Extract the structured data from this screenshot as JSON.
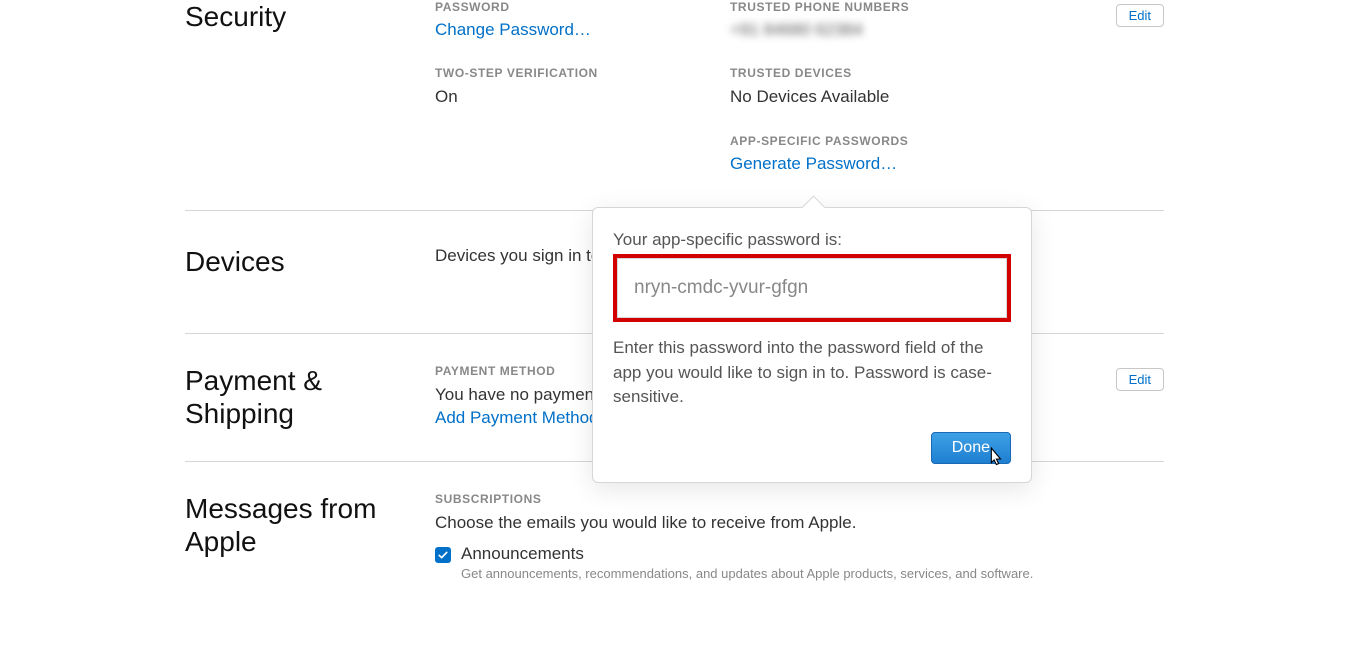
{
  "security": {
    "title": "Security",
    "password_label": "PASSWORD",
    "change_password": "Change Password…",
    "two_step_label": "TWO-STEP VERIFICATION",
    "two_step_value": "On",
    "trusted_phone_label": "TRUSTED PHONE NUMBERS",
    "trusted_phone_value": "+91 84680 62384",
    "trusted_devices_label": "TRUSTED DEVICES",
    "trusted_devices_value": "No Devices Available",
    "app_pw_label": "APP-SPECIFIC PASSWORDS",
    "generate_password": "Generate Password…",
    "edit_label": "Edit"
  },
  "devices": {
    "title": "Devices",
    "desc": "Devices you sign in to with your Apple ID will appear here."
  },
  "payment": {
    "title": "Payment & Shipping",
    "method_label": "PAYMENT METHOD",
    "no_method": "You have no payment method on file.",
    "add_method": "Add Payment Method…",
    "edit_label": "Edit"
  },
  "messages": {
    "title": "Messages from Apple",
    "subs_label": "SUBSCRIPTIONS",
    "subs_desc": "Choose the emails you would like to receive from Apple.",
    "announcements_label": "Announcements",
    "announcements_desc": "Get announcements, recommendations, and updates about Apple products, services, and software."
  },
  "popover": {
    "title": "Your app-specific password is:",
    "password": "nryn-cmdc-yvur-gfgn",
    "desc": "Enter this password into the password field of the app you would like to sign in to. Password is case-sensitive.",
    "done_label": "Done"
  }
}
